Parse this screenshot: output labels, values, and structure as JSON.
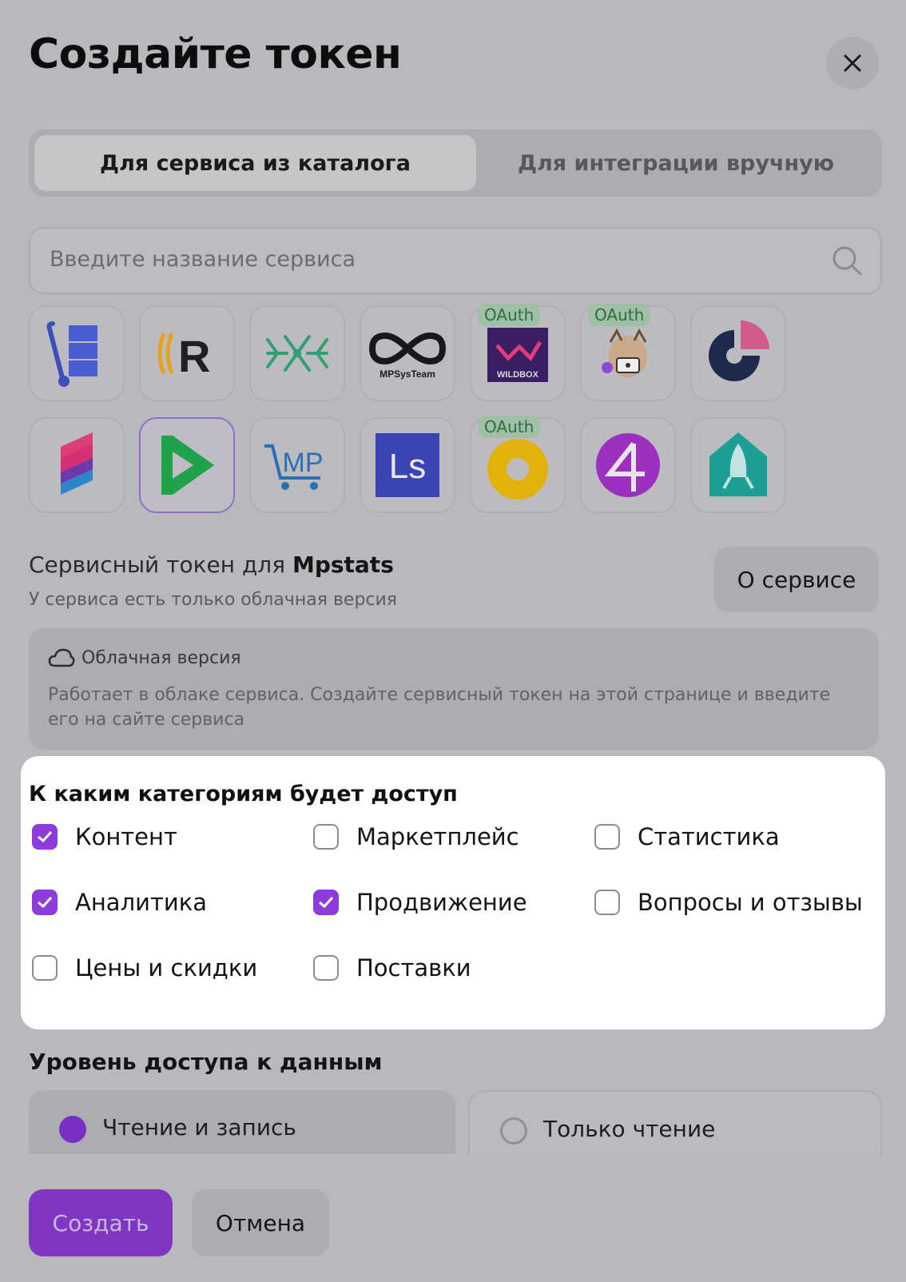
{
  "modal": {
    "title": "Создайте токен"
  },
  "tabs": [
    {
      "label": "Для сервиса из каталога",
      "active": true
    },
    {
      "label": "Для интеграции вручную",
      "active": false
    }
  ],
  "search": {
    "placeholder": "Введите название сервиса"
  },
  "services": [
    {
      "icon": "hand-truck-boxes-logo",
      "oauth": false,
      "selected": false
    },
    {
      "icon": "r-wave-logo",
      "oauth": false,
      "selected": false
    },
    {
      "icon": "green-network-arrows-logo",
      "oauth": false,
      "selected": false
    },
    {
      "icon": "mpsysteam-logo",
      "text": "MPSysTeam",
      "oauth": false,
      "selected": false
    },
    {
      "icon": "wildbox-logo",
      "text": "WILDBOX",
      "oauth": true,
      "selected": false
    },
    {
      "icon": "seller-mascot-logo",
      "oauth": true,
      "selected": false
    },
    {
      "icon": "pie-segment-logo",
      "oauth": false,
      "selected": false
    },
    {
      "icon": "layered-parallelograms-logo",
      "oauth": false,
      "selected": false
    },
    {
      "icon": "green-play-arrow-logo",
      "oauth": false,
      "selected": true
    },
    {
      "icon": "mp-cart-logo",
      "text": "MP",
      "oauth": false,
      "selected": false
    },
    {
      "icon": "ls-logo",
      "text": "Ls",
      "oauth": false,
      "selected": false
    },
    {
      "icon": "yellow-ring-logo",
      "oauth": true,
      "selected": false
    },
    {
      "icon": "purple-four-logo",
      "oauth": false,
      "selected": false
    },
    {
      "icon": "teal-rocket-house-logo",
      "oauth": false,
      "selected": false
    }
  ],
  "oauth_label": "OAuth",
  "service_info": {
    "title_prefix": "Сервисный токен для",
    "service_name": "Mpstats",
    "subtitle": "У сервиса есть только облачная версия",
    "about_button": "О сервисе"
  },
  "cloud_version": {
    "title": "Облачная версия",
    "description": "Работает в облаке сервиса. Создайте сервисный токен на этой странице и введите его на сайте сервиса"
  },
  "categories": {
    "title": "К каким категориям будет доступ",
    "items": [
      {
        "label": "Контент",
        "checked": true
      },
      {
        "label": "Маркетплейс",
        "checked": false
      },
      {
        "label": "Статистика",
        "checked": false
      },
      {
        "label": "Аналитика",
        "checked": true
      },
      {
        "label": "Продвижение",
        "checked": true
      },
      {
        "label": "Вопросы и отзывы",
        "checked": false
      },
      {
        "label": "Цены и скидки",
        "checked": false
      },
      {
        "label": "Поставки",
        "checked": false
      }
    ]
  },
  "access_level": {
    "title": "Уровень доступа к данным",
    "options": [
      {
        "label": "Чтение и запись",
        "selected": true
      },
      {
        "label": "Только чтение",
        "selected": false
      }
    ]
  },
  "actions": {
    "create": "Создать",
    "cancel": "Отмена"
  },
  "colors": {
    "accent": "#8e3bdb",
    "oauth_badge": "#9fbfa6",
    "dimmed_overlay": "#b9b9bd"
  }
}
